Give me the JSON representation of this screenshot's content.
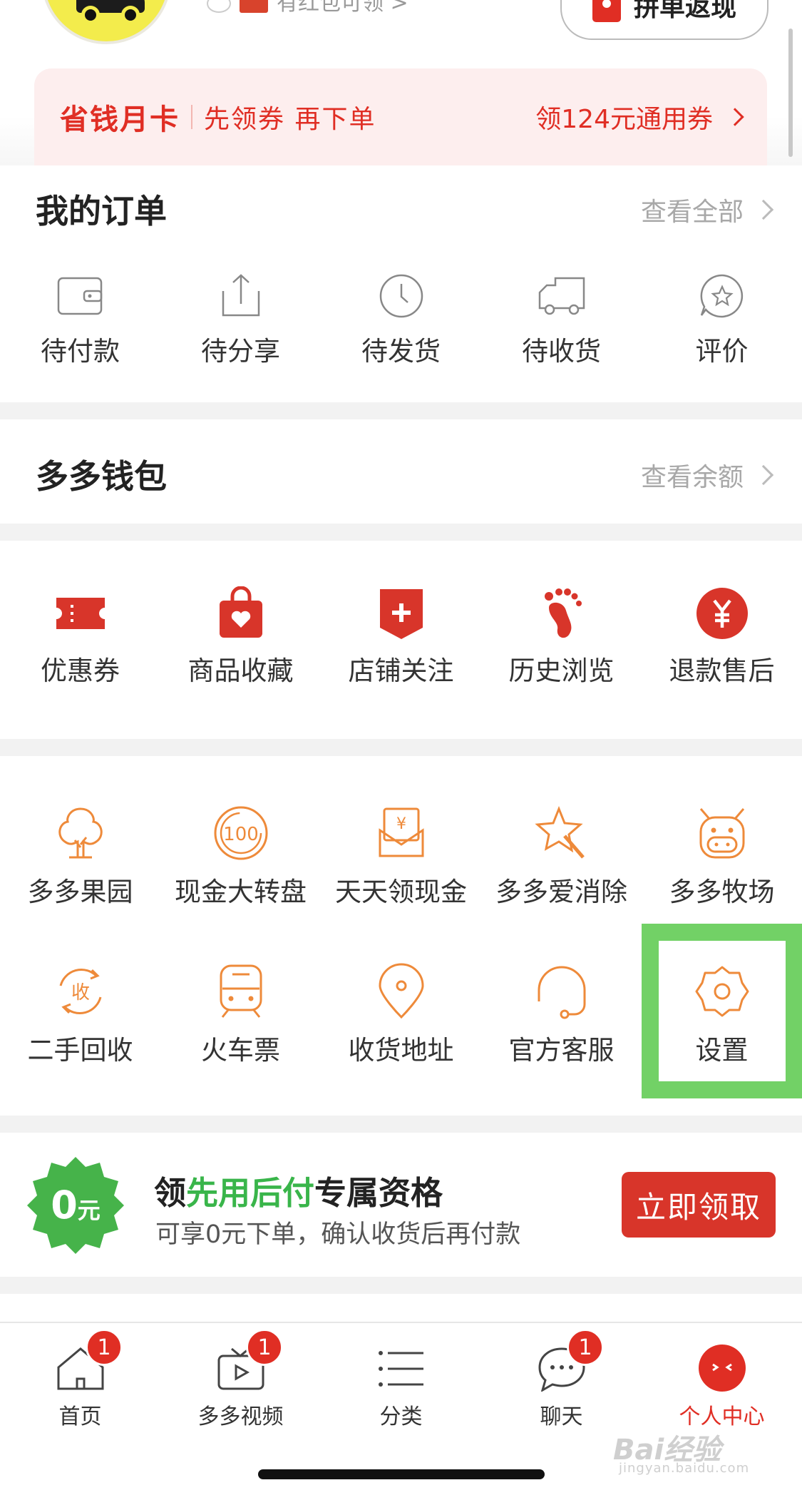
{
  "header": {
    "profile_sub_text": "有红包可领 >",
    "group_button_label": "拼单返现"
  },
  "promo": {
    "title": "省钱月卡",
    "subtitle": "先领券 再下单",
    "action": "领124元通用券"
  },
  "orders": {
    "title": "我的订单",
    "link": "查看全部",
    "items": [
      {
        "label": "待付款",
        "icon": "wallet-icon"
      },
      {
        "label": "待分享",
        "icon": "share-icon"
      },
      {
        "label": "待发货",
        "icon": "clock-icon"
      },
      {
        "label": "待收货",
        "icon": "truck-icon"
      },
      {
        "label": "评价",
        "icon": "review-icon"
      }
    ]
  },
  "wallet": {
    "title": "多多钱包",
    "link": "查看余额"
  },
  "quick": {
    "items": [
      {
        "label": "优惠券",
        "icon": "coupon-icon"
      },
      {
        "label": "商品收藏",
        "icon": "favorite-bag-icon"
      },
      {
        "label": "店铺关注",
        "icon": "store-follow-icon"
      },
      {
        "label": "历史浏览",
        "icon": "footprint-icon"
      },
      {
        "label": "退款售后",
        "icon": "refund-icon"
      }
    ]
  },
  "services": {
    "row1": [
      {
        "label": "多多果园",
        "icon": "tree-icon"
      },
      {
        "label": "现金大转盘",
        "icon": "wheel-100-icon"
      },
      {
        "label": "天天领现金",
        "icon": "cash-envelope-icon"
      },
      {
        "label": "多多爱消除",
        "icon": "star-wand-icon"
      },
      {
        "label": "多多牧场",
        "icon": "cow-icon"
      }
    ],
    "row2": [
      {
        "label": "二手回收",
        "icon": "recycle-icon"
      },
      {
        "label": "火车票",
        "icon": "train-icon"
      },
      {
        "label": "收货地址",
        "icon": "location-icon"
      },
      {
        "label": "官方客服",
        "icon": "headset-icon"
      },
      {
        "label": "设置",
        "icon": "settings-gear-icon"
      }
    ]
  },
  "first_use": {
    "badge_number": "0",
    "badge_unit": "元",
    "title_prefix": "领",
    "title_highlight": "先用后付",
    "title_suffix": "专属资格",
    "subtitle": "可享0元下单，确认收货后再付款",
    "button": "立即领取"
  },
  "bottom_nav": {
    "items": [
      {
        "label": "首页",
        "badge": "1",
        "icon": "home-icon"
      },
      {
        "label": "多多视频",
        "badge": "1",
        "icon": "video-icon"
      },
      {
        "label": "分类",
        "badge": "",
        "icon": "category-list-icon"
      },
      {
        "label": "聊天",
        "badge": "1",
        "icon": "chat-icon"
      },
      {
        "label": "个人中心",
        "badge": "",
        "icon": "profile-icon"
      }
    ]
  },
  "watermark": {
    "brand": "Bai经验",
    "url": "jingyan.baidu.com"
  },
  "colors": {
    "brand_red": "#e02e24",
    "icon_orange": "#ee8a3a",
    "highlight_green": "#72d166",
    "first_use_green": "#39b54a"
  }
}
